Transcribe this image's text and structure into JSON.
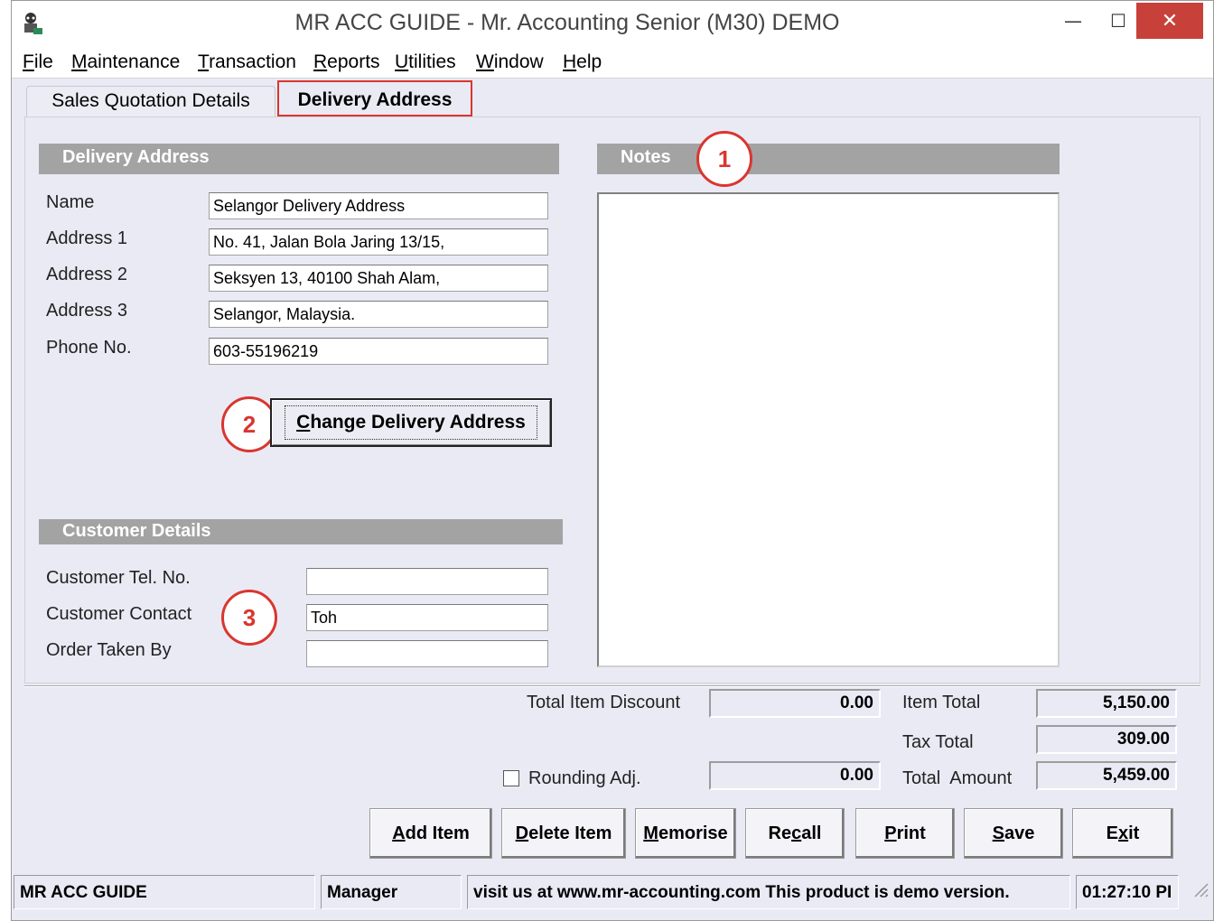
{
  "window": {
    "title": "MR ACC GUIDE - Mr. Accounting Senior (M30) DEMO",
    "minimize_glyph": "—",
    "maximize_glyph": "☐",
    "close_glyph": "✕"
  },
  "menu": [
    {
      "label": "File",
      "mnemonic": "F",
      "rest": "ile"
    },
    {
      "label": "Maintenance",
      "mnemonic": "M",
      "rest": "aintenance"
    },
    {
      "label": "Transaction",
      "mnemonic": "T",
      "rest": "ransaction"
    },
    {
      "label": "Reports",
      "mnemonic": "R",
      "rest": "eports"
    },
    {
      "label": "Utilities",
      "mnemonic": "U",
      "rest": "tilities"
    },
    {
      "label": "Window",
      "mnemonic": "W",
      "rest": "indow"
    },
    {
      "label": "Help",
      "mnemonic": "H",
      "rest": "elp"
    }
  ],
  "tabs": {
    "sales_quotation": "Sales Quotation Details",
    "delivery_address": "Delivery Address"
  },
  "delivery": {
    "header": "Delivery Address",
    "name_label": "Name",
    "name_value": "Selangor Delivery Address",
    "address1_label": "Address 1",
    "address1_value": "No. 41, Jalan Bola Jaring 13/15,",
    "address2_label": "Address 2",
    "address2_value": "Seksyen 13, 40100 Shah Alam,",
    "address3_label": "Address 3",
    "address3_value": "Selangor, Malaysia.",
    "phone_label": "Phone No.",
    "phone_value": "603-55196219",
    "change_button_mnemonic": "C",
    "change_button_rest": "hange Delivery Address"
  },
  "notes": {
    "header": "Notes",
    "value": ""
  },
  "customer": {
    "header": "Customer Details",
    "tel_label": "Customer Tel. No.",
    "tel_value": "",
    "contact_label": "Customer Contact",
    "contact_value": "Toh",
    "order_label": "Order Taken By",
    "order_value": ""
  },
  "callouts": {
    "one": "1",
    "two": "2",
    "three": "3"
  },
  "totals": {
    "item_discount_label": "Total Item Discount",
    "item_discount_value": "0.00",
    "item_total_label": "Item Total",
    "item_total_value": "5,150.00",
    "tax_total_label": "Tax Total",
    "tax_total_value": "309.00",
    "rounding_label": "Rounding Adj.",
    "rounding_value": "0.00",
    "rounding_checked": false,
    "total_amount_label": "Total  Amount",
    "total_amount_value": "5,459.00"
  },
  "buttons": [
    {
      "key": "add-item",
      "pre": "",
      "mnemonic": "A",
      "rest": "dd Item"
    },
    {
      "key": "delete-item",
      "pre": "",
      "mnemonic": "D",
      "rest": "elete Item"
    },
    {
      "key": "memorise",
      "pre": "",
      "mnemonic": "M",
      "rest": "emorise"
    },
    {
      "key": "recall",
      "pre": "Re",
      "mnemonic": "c",
      "rest": "all"
    },
    {
      "key": "print",
      "pre": "",
      "mnemonic": "P",
      "rest": "rint"
    },
    {
      "key": "save",
      "pre": "",
      "mnemonic": "S",
      "rest": "ave"
    },
    {
      "key": "exit",
      "pre": "E",
      "mnemonic": "x",
      "rest": "it"
    }
  ],
  "status": {
    "app": "MR ACC GUIDE",
    "user": "Manager",
    "message": "visit us at www.mr-accounting.com This product is demo version.",
    "time": "01:27:10 PI"
  }
}
